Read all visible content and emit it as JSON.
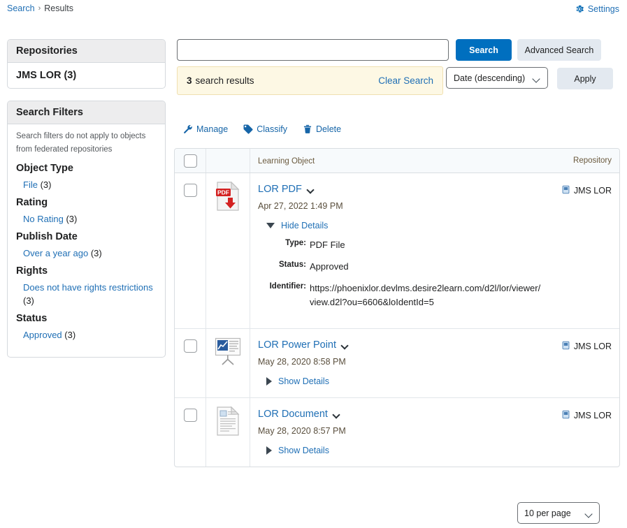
{
  "breadcrumb": {
    "root": "Search",
    "separator": "›",
    "current": "Results"
  },
  "settings": {
    "label": "Settings",
    "icon": "gear-icon",
    "color": "#1f6fb5"
  },
  "repositories": {
    "title": "Repositories",
    "items": [
      {
        "label": "JMS LOR (3)"
      }
    ]
  },
  "filters": {
    "title": "Search Filters",
    "note": "Search filters do not apply to objects from federated repositories",
    "groups": [
      {
        "title": "Object Type",
        "options": [
          {
            "label": "File",
            "count": "(3)"
          }
        ]
      },
      {
        "title": "Rating",
        "options": [
          {
            "label": "No Rating",
            "count": "(3)"
          }
        ]
      },
      {
        "title": "Publish Date",
        "options": [
          {
            "label": "Over a year ago",
            "count": "(3)"
          }
        ]
      },
      {
        "title": "Rights",
        "options": [
          {
            "label": "Does not have rights restrictions",
            "count": "(3)"
          }
        ]
      },
      {
        "title": "Status",
        "options": [
          {
            "label": "Approved",
            "count": "(3)"
          }
        ]
      }
    ]
  },
  "search": {
    "value": "",
    "placeholder": "",
    "search_button": "Search",
    "advanced_button": "Advanced Search"
  },
  "results_banner": {
    "count": "3",
    "text": "search results",
    "clear": "Clear Search"
  },
  "sort": {
    "selected": "Date (descending)",
    "apply_label": "Apply"
  },
  "actions": [
    {
      "label": "Manage",
      "icon": "wrench-icon"
    },
    {
      "label": "Classify",
      "icon": "tag-icon"
    },
    {
      "label": "Delete",
      "icon": "trash-icon"
    }
  ],
  "table": {
    "headers": {
      "learning_object": "Learning Object",
      "repository": "Repository"
    },
    "rows": [
      {
        "title": "LOR PDF",
        "date": "Apr 27, 2022 1:49 PM",
        "repository": "JMS LOR",
        "icon": "pdf-file-icon",
        "details_label": "Hide Details",
        "expanded": true,
        "details": [
          {
            "label": "Type:",
            "value": "PDF File"
          },
          {
            "label": "Status:",
            "value": "Approved"
          },
          {
            "label": "Identifier:",
            "value": "https://phoenixlor.devlms.desire2learn.com/d2l/lor/viewer/view.d2l?ou=6606&loIdentId=5"
          }
        ]
      },
      {
        "title": "LOR Power Point",
        "date": "May 28, 2020 8:58 PM",
        "repository": "JMS LOR",
        "icon": "presentation-icon",
        "details_label": "Show Details",
        "expanded": false,
        "details": []
      },
      {
        "title": "LOR Document",
        "date": "May 28, 2020 8:57 PM",
        "repository": "JMS LOR",
        "icon": "document-icon",
        "details_label": "Show Details",
        "expanded": false,
        "details": []
      }
    ]
  },
  "pagination": {
    "per_page": "10 per page"
  },
  "colors": {
    "link": "#1f6fb5",
    "primary_button": "#006fbf",
    "banner_bg": "#fdf8e4",
    "panel_head_bg": "#ededee"
  }
}
